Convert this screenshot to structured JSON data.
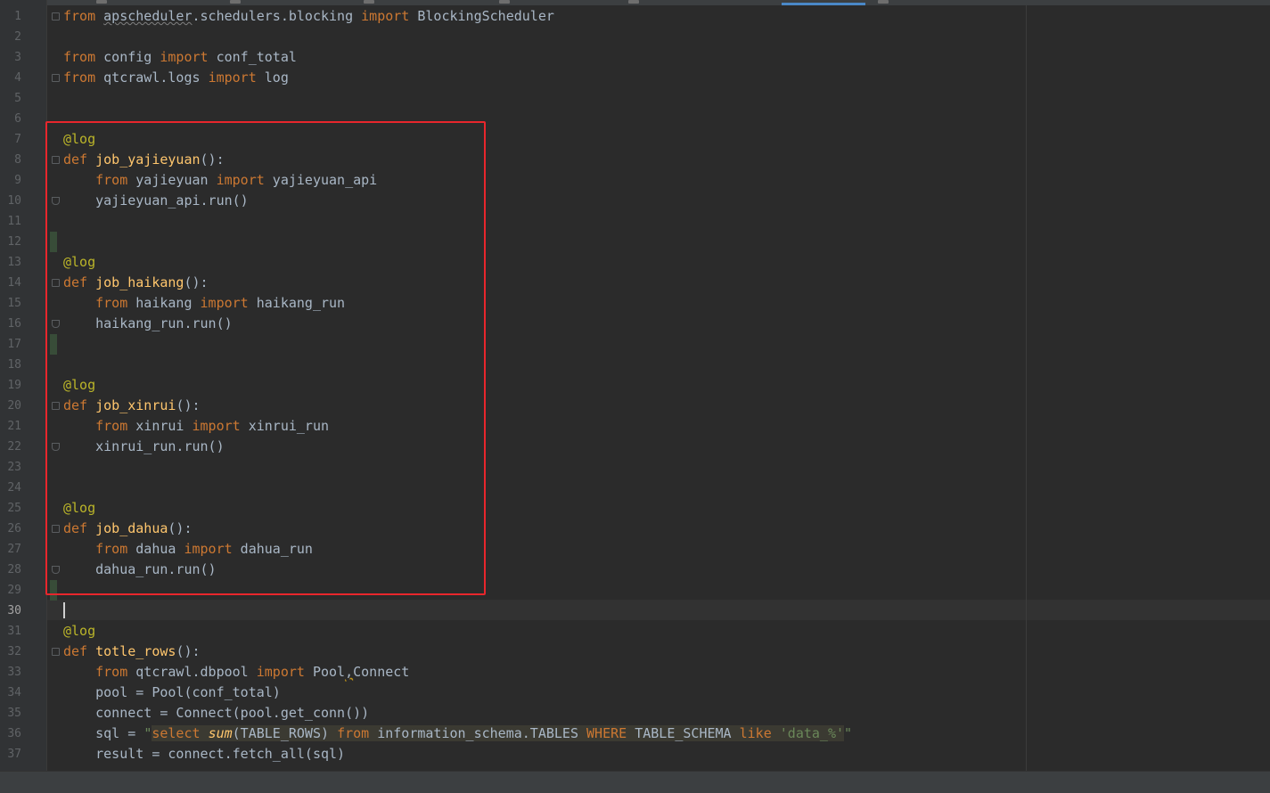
{
  "editor": {
    "current_line": "30",
    "lines": [
      {
        "n": "1",
        "tokens": [
          {
            "t": "from",
            "c": "kw"
          },
          {
            "t": " "
          },
          {
            "t": "apscheduler",
            "c": "squiggle"
          },
          {
            "t": ".schedulers.blocking "
          },
          {
            "t": "import",
            "c": "kw"
          },
          {
            "t": " BlockingScheduler"
          }
        ]
      },
      {
        "n": "2",
        "tokens": []
      },
      {
        "n": "3",
        "tokens": [
          {
            "t": "from",
            "c": "kw"
          },
          {
            "t": " config "
          },
          {
            "t": "import",
            "c": "kw"
          },
          {
            "t": " conf_total"
          }
        ]
      },
      {
        "n": "4",
        "tokens": [
          {
            "t": "from",
            "c": "kw"
          },
          {
            "t": " qtcrawl.logs "
          },
          {
            "t": "import",
            "c": "kw"
          },
          {
            "t": " log"
          }
        ]
      },
      {
        "n": "5",
        "tokens": []
      },
      {
        "n": "6",
        "tokens": []
      },
      {
        "n": "7",
        "tokens": [
          {
            "t": "@log",
            "c": "dec"
          }
        ]
      },
      {
        "n": "8",
        "tokens": [
          {
            "t": "def",
            "c": "kw"
          },
          {
            "t": " "
          },
          {
            "t": "job_yajieyuan",
            "c": "fn"
          },
          {
            "t": "():"
          }
        ]
      },
      {
        "n": "9",
        "tokens": [
          {
            "t": "    "
          },
          {
            "t": "from",
            "c": "kw"
          },
          {
            "t": " yajieyuan "
          },
          {
            "t": "import",
            "c": "kw"
          },
          {
            "t": " yajieyuan_api"
          }
        ]
      },
      {
        "n": "10",
        "tokens": [
          {
            "t": "    yajieyuan_api.run()"
          }
        ]
      },
      {
        "n": "11",
        "tokens": []
      },
      {
        "n": "12",
        "tokens": []
      },
      {
        "n": "13",
        "tokens": [
          {
            "t": "@log",
            "c": "dec"
          }
        ]
      },
      {
        "n": "14",
        "tokens": [
          {
            "t": "def",
            "c": "kw"
          },
          {
            "t": " "
          },
          {
            "t": "job_haikang",
            "c": "fn"
          },
          {
            "t": "():"
          }
        ]
      },
      {
        "n": "15",
        "tokens": [
          {
            "t": "    "
          },
          {
            "t": "from",
            "c": "kw"
          },
          {
            "t": " haikang "
          },
          {
            "t": "import",
            "c": "kw"
          },
          {
            "t": " haikang_run"
          }
        ]
      },
      {
        "n": "16",
        "tokens": [
          {
            "t": "    haikang_run.run()"
          }
        ]
      },
      {
        "n": "17",
        "tokens": []
      },
      {
        "n": "18",
        "tokens": []
      },
      {
        "n": "19",
        "tokens": [
          {
            "t": "@log",
            "c": "dec"
          }
        ]
      },
      {
        "n": "20",
        "tokens": [
          {
            "t": "def",
            "c": "kw"
          },
          {
            "t": " "
          },
          {
            "t": "job_xinrui",
            "c": "fn"
          },
          {
            "t": "():"
          }
        ]
      },
      {
        "n": "21",
        "tokens": [
          {
            "t": "    "
          },
          {
            "t": "from",
            "c": "kw"
          },
          {
            "t": " xinrui "
          },
          {
            "t": "import",
            "c": "kw"
          },
          {
            "t": " xinrui_run"
          }
        ]
      },
      {
        "n": "22",
        "tokens": [
          {
            "t": "    xinrui_run.run()"
          }
        ]
      },
      {
        "n": "23",
        "tokens": []
      },
      {
        "n": "24",
        "tokens": []
      },
      {
        "n": "25",
        "tokens": [
          {
            "t": "@log",
            "c": "dec"
          }
        ]
      },
      {
        "n": "26",
        "tokens": [
          {
            "t": "def",
            "c": "kw"
          },
          {
            "t": " "
          },
          {
            "t": "job_dahua",
            "c": "fn"
          },
          {
            "t": "():"
          }
        ]
      },
      {
        "n": "27",
        "tokens": [
          {
            "t": "    "
          },
          {
            "t": "from",
            "c": "kw"
          },
          {
            "t": " dahua "
          },
          {
            "t": "import",
            "c": "kw"
          },
          {
            "t": " dahua_run"
          }
        ]
      },
      {
        "n": "28",
        "tokens": [
          {
            "t": "    dahua_run.run()"
          }
        ]
      },
      {
        "n": "29",
        "tokens": []
      },
      {
        "n": "30",
        "tokens": []
      },
      {
        "n": "31",
        "tokens": [
          {
            "t": "@log",
            "c": "dec"
          }
        ]
      },
      {
        "n": "32",
        "tokens": [
          {
            "t": "def",
            "c": "kw"
          },
          {
            "t": " "
          },
          {
            "t": "totle_rows",
            "c": "fn"
          },
          {
            "t": "():"
          }
        ]
      },
      {
        "n": "33",
        "tokens": [
          {
            "t": "    "
          },
          {
            "t": "from",
            "c": "kw"
          },
          {
            "t": " qtcrawl.dbpool "
          },
          {
            "t": "import",
            "c": "kw"
          },
          {
            "t": " Pool"
          },
          {
            "t": ",",
            "c": "warnmark"
          },
          {
            "t": "Connect"
          }
        ]
      },
      {
        "n": "34",
        "tokens": [
          {
            "t": "    pool = Pool(conf_total)"
          }
        ]
      },
      {
        "n": "35",
        "tokens": [
          {
            "t": "    connect = Connect(pool.get_conn())"
          }
        ]
      },
      {
        "n": "36",
        "tokens": [
          {
            "t": "    sql = "
          },
          {
            "t": "\"",
            "c": "str"
          },
          {
            "t": "select",
            "c": "sqlbg sqlkw"
          },
          {
            "t": " ",
            "c": "sqlbg"
          },
          {
            "t": "sum",
            "c": "sqlbg sqlfn"
          },
          {
            "t": "(TABLE_ROWS) ",
            "c": "sqlbg"
          },
          {
            "t": "from",
            "c": "sqlbg sqlkw"
          },
          {
            "t": " information_schema.TABLES ",
            "c": "sqlbg"
          },
          {
            "t": "WHERE",
            "c": "sqlbg sqlkw"
          },
          {
            "t": " TABLE_SCHEMA ",
            "c": "sqlbg"
          },
          {
            "t": "like",
            "c": "sqlbg sqlkw"
          },
          {
            "t": " ",
            "c": "sqlbg"
          },
          {
            "t": "'data_%'",
            "c": "sqlbg sqlstr"
          },
          {
            "t": "\"",
            "c": "str"
          }
        ]
      },
      {
        "n": "37",
        "tokens": [
          {
            "t": "    result = connect.fetch_all(sql)"
          }
        ]
      }
    ]
  }
}
